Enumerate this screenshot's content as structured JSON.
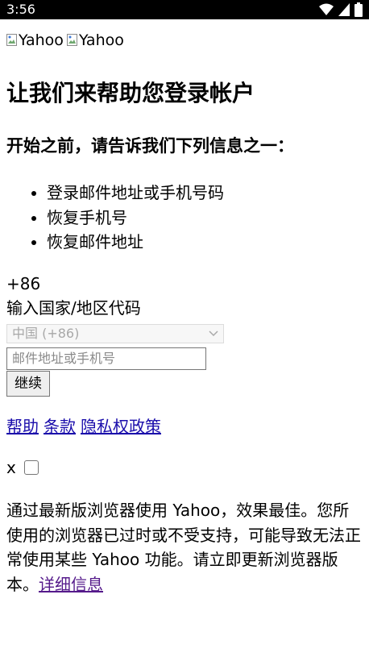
{
  "status_bar": {
    "time": "3:56"
  },
  "logos": {
    "alt_1": "Yahoo",
    "alt_2": "Yahoo"
  },
  "heading": "让我们来帮助您登录帐户",
  "subheading": "开始之前，请告诉我们下列信息之一：",
  "options": [
    "登录邮件地址或手机号码",
    "恢复手机号",
    "恢复邮件地址"
  ],
  "form": {
    "country_code": "+86",
    "country_label": "输入国家/地区代码",
    "country_select_value": "中国 (+86)",
    "identifier_placeholder": "邮件地址或手机号",
    "continue_label": "继续"
  },
  "footer_links": {
    "help": "帮助",
    "terms": "条款",
    "privacy": "隐私权政策"
  },
  "banner": {
    "close_label": "x",
    "message": "通过最新版浏览器使用 Yahoo，效果最佳。您所使用的浏览器已过时或不受支持，可能导致无法正常使用某些 Yahoo 功能。请立即更新浏览器版本。",
    "more_link": "详细信息"
  },
  "icons": [
    "wifi-icon",
    "signal-icon",
    "battery-icon",
    "broken-image-icon",
    "chevron-down-icon"
  ]
}
